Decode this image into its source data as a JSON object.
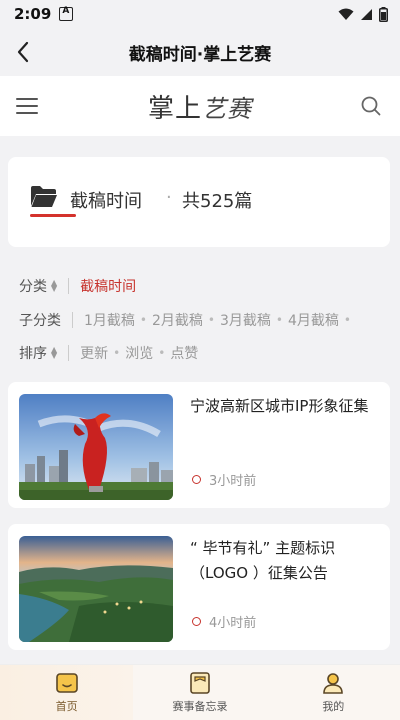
{
  "status_bar": {
    "time": "2:09"
  },
  "title_bar": {
    "title": "截稿时间·掌上艺赛"
  },
  "app_header": {
    "logo_text": "掌上",
    "logo_script": "艺赛"
  },
  "category": {
    "name": "截稿时间",
    "separator": "·",
    "count": "共525篇"
  },
  "filters": {
    "category_label": "分类",
    "category_value": "截稿时间",
    "subcategory_label": "子分类",
    "subcategories": [
      "1月截稿",
      "2月截稿",
      "3月截稿",
      "4月截稿"
    ],
    "sort_label": "排序",
    "sort_options": [
      "更新",
      "浏览",
      "点赞"
    ]
  },
  "articles": [
    {
      "title": "宁波高新区城市IP形象征集",
      "time": "3小时前"
    },
    {
      "title": "“ 毕节有礼” 主题标识（LOGO ）征集公告",
      "time": "4小时前"
    }
  ],
  "bottom_nav": [
    {
      "label": "首页",
      "icon": "home-icon"
    },
    {
      "label": "赛事备忘录",
      "icon": "memo-icon"
    },
    {
      "label": "我的",
      "icon": "profile-icon"
    }
  ],
  "colors": {
    "accent": "#c7332d",
    "background": "#f2f2f4",
    "card": "#ffffff"
  }
}
